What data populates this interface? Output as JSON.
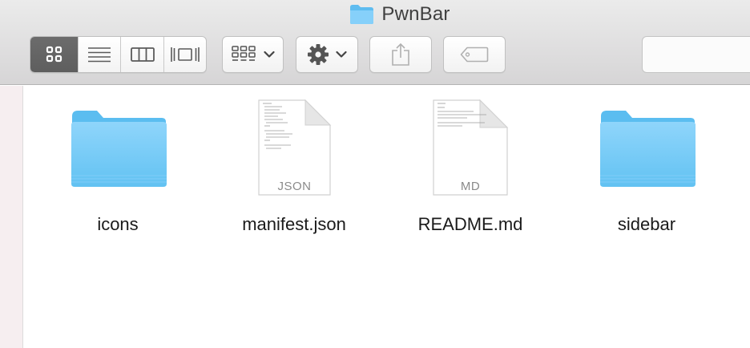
{
  "window": {
    "title": "PwnBar"
  },
  "toolbar": {
    "view_modes": [
      {
        "name": "icon-view",
        "active": true
      },
      {
        "name": "list-view",
        "active": false
      },
      {
        "name": "column-view",
        "active": false
      },
      {
        "name": "cover-flow-view",
        "active": false
      }
    ],
    "arrange_icon": "arrange-grid-icon",
    "action_icon": "gear-icon",
    "share_icon": "share-icon",
    "tags_icon": "tag-icon"
  },
  "files": [
    {
      "name": "icons",
      "type": "folder"
    },
    {
      "name": "manifest.json",
      "type": "document",
      "ext": "JSON"
    },
    {
      "name": "README.md",
      "type": "document",
      "ext": "MD"
    },
    {
      "name": "sidebar",
      "type": "folder"
    }
  ],
  "colors": {
    "folder_top": "#8fd5fb",
    "folder_bottom": "#57bcef",
    "active_segment": "#656565"
  }
}
